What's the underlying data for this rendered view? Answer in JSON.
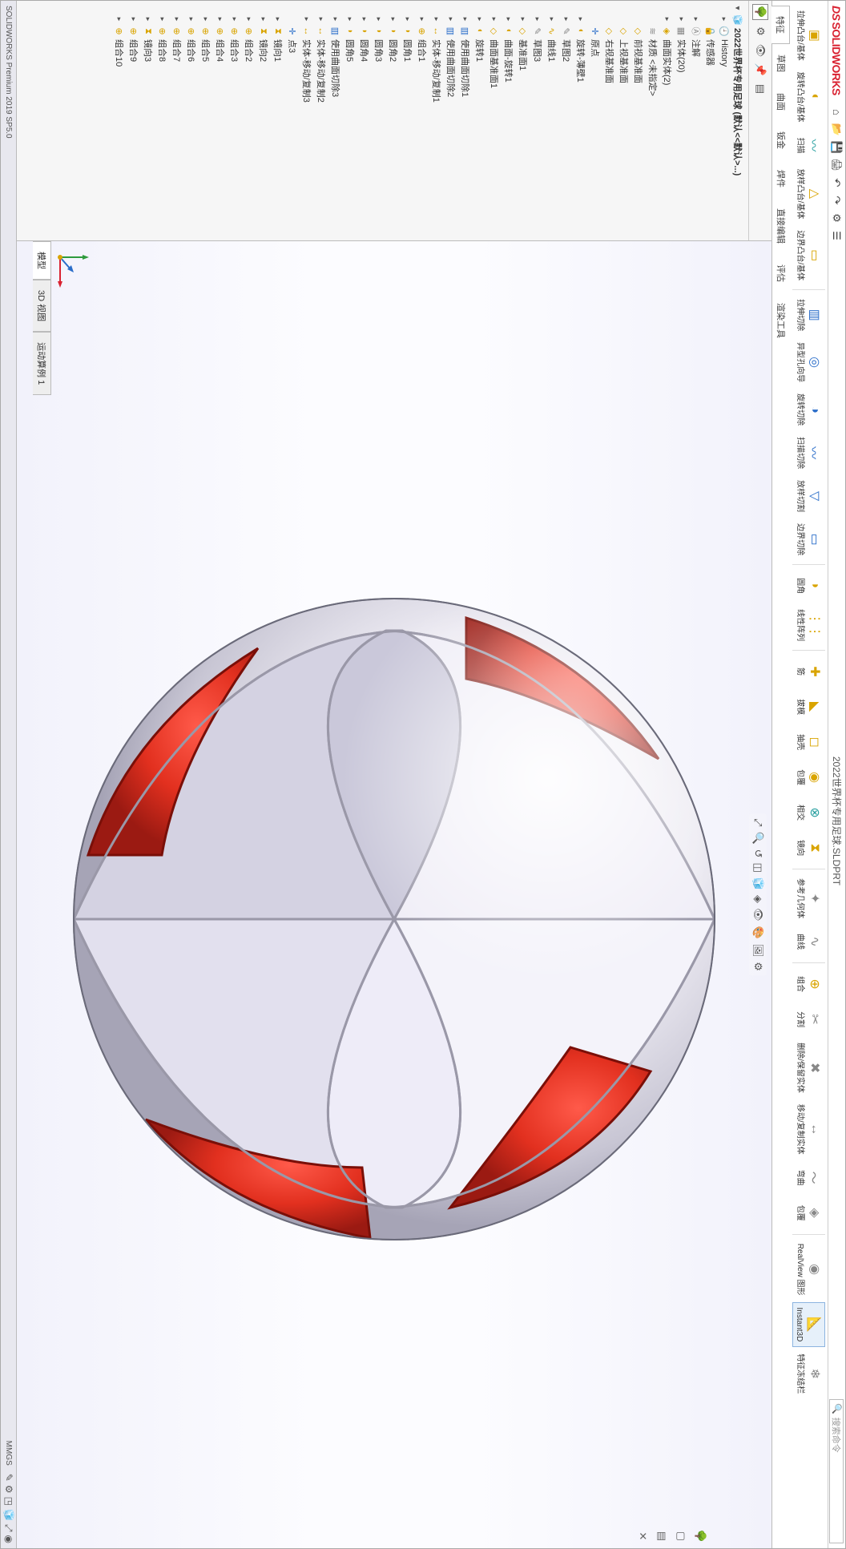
{
  "app": {
    "name": "SOLIDWORKS",
    "document": "2022世界杯专用足球.SLDPRT",
    "search_placeholder": "搜索命令"
  },
  "qat": [
    "home-icon",
    "open-icon",
    "save-icon",
    "print-icon",
    "undo-icon",
    "redo-icon",
    "settings-icon",
    "options-icon"
  ],
  "ribbon": {
    "row1": [
      {
        "id": "boss-extrude",
        "lbl": "拉伸凸台/基体",
        "glyph": "▣",
        "color": "c-yel"
      },
      {
        "id": "revolve-boss",
        "lbl": "旋转凸台/基体",
        "glyph": "◐",
        "color": "c-yel"
      },
      {
        "id": "sweep",
        "lbl": "扫描",
        "glyph": "〰",
        "color": "c-teal"
      },
      {
        "id": "loft",
        "lbl": "放样凸台/基体",
        "glyph": "△",
        "color": "c-yel"
      },
      {
        "id": "boundary",
        "lbl": "边界凸台/基体",
        "glyph": "▭",
        "color": "c-yel"
      },
      {
        "sep": true
      },
      {
        "id": "cut-extrude",
        "lbl": "拉伸切除",
        "glyph": "▥",
        "color": "c-blue"
      },
      {
        "id": "hole-wizard",
        "lbl": "异型孔向导",
        "glyph": "◎",
        "color": "c-blue"
      },
      {
        "id": "cut-revolve",
        "lbl": "旋转切除",
        "glyph": "◑",
        "color": "c-blue"
      },
      {
        "id": "cut-sweep",
        "lbl": "扫描切除",
        "glyph": "〰",
        "color": "c-blue"
      },
      {
        "id": "cut-loft",
        "lbl": "放样切割",
        "glyph": "▽",
        "color": "c-blue"
      },
      {
        "id": "cut-boundary",
        "lbl": "边界切除",
        "glyph": "▭",
        "color": "c-blue"
      },
      {
        "sep": true
      },
      {
        "id": "fillet",
        "lbl": "圆角",
        "glyph": "◗",
        "color": "c-yel"
      },
      {
        "id": "pattern",
        "lbl": "线性阵列",
        "glyph": "⋮⋮",
        "color": "c-yel"
      },
      {
        "sep": true
      },
      {
        "id": "rib",
        "lbl": "筋",
        "glyph": "✚",
        "color": "c-yel"
      },
      {
        "id": "draft",
        "lbl": "拔模",
        "glyph": "◣",
        "color": "c-yel"
      },
      {
        "id": "shell",
        "lbl": "抽壳",
        "glyph": "◻",
        "color": "c-yel"
      },
      {
        "id": "wrap",
        "lbl": "包覆",
        "glyph": "◉",
        "color": "c-yel"
      },
      {
        "id": "intersect",
        "lbl": "相交",
        "glyph": "⊗",
        "color": "c-teal"
      },
      {
        "id": "mirror",
        "lbl": "镜向",
        "glyph": "⧗",
        "color": "c-yel"
      },
      {
        "sep": true
      },
      {
        "id": "ref-geom",
        "lbl": "参考几何体",
        "glyph": "✦",
        "color": "c-gray"
      },
      {
        "id": "curves",
        "lbl": "曲线",
        "glyph": "∿",
        "color": "c-gray"
      },
      {
        "sep": true
      },
      {
        "id": "combine",
        "lbl": "组合",
        "glyph": "⊕",
        "color": "c-yel"
      },
      {
        "id": "split",
        "lbl": "分割",
        "glyph": "✂",
        "color": "c-gray"
      },
      {
        "id": "delete-body",
        "lbl": "删除/保留实体",
        "glyph": "✖",
        "color": "c-gray"
      },
      {
        "id": "move-body",
        "lbl": "移动/复制实体",
        "glyph": "↔",
        "color": "c-gray"
      },
      {
        "id": "flex",
        "lbl": "弯曲",
        "glyph": "〜",
        "color": "c-gray"
      },
      {
        "id": "convert",
        "lbl": "包覆",
        "glyph": "◈",
        "color": "c-gray"
      },
      {
        "sep": true
      },
      {
        "id": "realview",
        "lbl": "RealView 图形",
        "glyph": "◉",
        "color": "c-gray"
      },
      {
        "id": "instant3d",
        "lbl": "Instant3D",
        "glyph": "📐",
        "color": "c-yel",
        "active": true
      },
      {
        "id": "feature-repair",
        "lbl": "特征冻结栏",
        "glyph": "❄",
        "color": "c-gray"
      }
    ],
    "tabs": [
      "特征",
      "草图",
      "曲面",
      "钣金",
      "焊件",
      "直接编辑",
      "评估",
      "渲染工具"
    ]
  },
  "side_tabs": [
    "feature-tree-icon",
    "config-icon",
    "display-icon",
    "pin-icon",
    "expand-icon"
  ],
  "tree": [
    {
      "d": 0,
      "exp": "▾",
      "ico": "🧊",
      "lbl": "2022世界杯专用足球 (默认<<默认>...)",
      "root": true,
      "color": "c-yel"
    },
    {
      "d": 1,
      "exp": "▸",
      "ico": "🕘",
      "lbl": "History",
      "color": "c-gray"
    },
    {
      "d": 1,
      "exp": " ",
      "ico": "🔒",
      "lbl": "传感器",
      "color": "c-blue"
    },
    {
      "d": 1,
      "exp": "▸",
      "ico": "Ⓐ",
      "lbl": "注解",
      "color": "c-gray"
    },
    {
      "d": 1,
      "exp": "▸",
      "ico": "▦",
      "lbl": "实体(20)",
      "color": "c-gray"
    },
    {
      "d": 1,
      "exp": "▸",
      "ico": "◈",
      "lbl": "曲面实体(2)",
      "color": "c-yel"
    },
    {
      "d": 1,
      "exp": " ",
      "ico": "≋",
      "lbl": "材质 <未指定>",
      "color": "c-gray"
    },
    {
      "d": 1,
      "exp": " ",
      "ico": "◇",
      "lbl": "前视基准面",
      "color": "c-yel"
    },
    {
      "d": 1,
      "exp": " ",
      "ico": "◇",
      "lbl": "上视基准面",
      "color": "c-yel"
    },
    {
      "d": 1,
      "exp": " ",
      "ico": "◇",
      "lbl": "右视基准面",
      "color": "c-yel"
    },
    {
      "d": 1,
      "exp": " ",
      "ico": "✛",
      "lbl": "原点",
      "color": "c-blue"
    },
    {
      "d": 1,
      "exp": "▸",
      "ico": "◐",
      "lbl": "旋转-薄壁1",
      "color": "c-yel"
    },
    {
      "d": 1,
      "exp": "▸",
      "ico": "✎",
      "lbl": "草图2",
      "color": "c-gray"
    },
    {
      "d": 1,
      "exp": "▸",
      "ico": "∿",
      "lbl": "曲线1",
      "color": "c-yel"
    },
    {
      "d": 1,
      "exp": "▸",
      "ico": "✎",
      "lbl": "草图3",
      "color": "c-gray"
    },
    {
      "d": 1,
      "exp": "▸",
      "ico": "◇",
      "lbl": "基准面1",
      "color": "c-yel"
    },
    {
      "d": 1,
      "exp": "▸",
      "ico": "◐",
      "lbl": "曲面-旋转1",
      "color": "c-yel"
    },
    {
      "d": 1,
      "exp": "▸",
      "ico": "◇",
      "lbl": "曲面基准面1",
      "color": "c-yel"
    },
    {
      "d": 1,
      "exp": "▸",
      "ico": "◐",
      "lbl": "旋转1",
      "color": "c-yel"
    },
    {
      "d": 1,
      "exp": "▸",
      "ico": "▥",
      "lbl": "使用曲面切除1",
      "color": "c-blue"
    },
    {
      "d": 1,
      "exp": "▸",
      "ico": "▥",
      "lbl": "使用曲面切除2",
      "color": "c-blue"
    },
    {
      "d": 1,
      "exp": "▸",
      "ico": "↔",
      "lbl": "实体-移动/复制1",
      "color": "c-yel"
    },
    {
      "d": 1,
      "exp": "▸",
      "ico": "⊕",
      "lbl": "组合1",
      "color": "c-yel"
    },
    {
      "d": 1,
      "exp": "▸",
      "ico": "◗",
      "lbl": "圆角1",
      "color": "c-yel"
    },
    {
      "d": 1,
      "exp": "▸",
      "ico": "◗",
      "lbl": "圆角2",
      "color": "c-yel"
    },
    {
      "d": 1,
      "exp": "▸",
      "ico": "◗",
      "lbl": "圆角3",
      "color": "c-yel"
    },
    {
      "d": 1,
      "exp": "▸",
      "ico": "◗",
      "lbl": "圆角4",
      "color": "c-yel"
    },
    {
      "d": 1,
      "exp": "▸",
      "ico": "◗",
      "lbl": "圆角5",
      "color": "c-yel"
    },
    {
      "d": 1,
      "exp": "▸",
      "ico": "▥",
      "lbl": "使用曲面切除3",
      "color": "c-blue"
    },
    {
      "d": 1,
      "exp": "▸",
      "ico": "↔",
      "lbl": "实体-移动/复制2",
      "color": "c-yel"
    },
    {
      "d": 1,
      "exp": "▸",
      "ico": "↔",
      "lbl": "实体-移动/复制3",
      "color": "c-yel"
    },
    {
      "d": 1,
      "exp": " ",
      "ico": "✛",
      "lbl": "点3",
      "color": "c-blue"
    },
    {
      "d": 1,
      "exp": "▸",
      "ico": "⧗",
      "lbl": "镜向1",
      "color": "c-yel"
    },
    {
      "d": 1,
      "exp": "▸",
      "ico": "⧗",
      "lbl": "镜向2",
      "color": "c-yel"
    },
    {
      "d": 1,
      "exp": "▸",
      "ico": "⊕",
      "lbl": "组合2",
      "color": "c-yel"
    },
    {
      "d": 1,
      "exp": "▸",
      "ico": "⊕",
      "lbl": "组合3",
      "color": "c-yel"
    },
    {
      "d": 1,
      "exp": "▸",
      "ico": "⊕",
      "lbl": "组合4",
      "color": "c-yel"
    },
    {
      "d": 1,
      "exp": "▸",
      "ico": "⊕",
      "lbl": "组合5",
      "color": "c-yel"
    },
    {
      "d": 1,
      "exp": "▸",
      "ico": "⊕",
      "lbl": "组合6",
      "color": "c-yel"
    },
    {
      "d": 1,
      "exp": "▸",
      "ico": "⊕",
      "lbl": "组合7",
      "color": "c-yel"
    },
    {
      "d": 1,
      "exp": "▸",
      "ico": "⊕",
      "lbl": "组合8",
      "color": "c-yel"
    },
    {
      "d": 1,
      "exp": "▸",
      "ico": "⧗",
      "lbl": "镜向3",
      "color": "c-yel"
    },
    {
      "d": 1,
      "exp": "▸",
      "ico": "⊕",
      "lbl": "组合9",
      "color": "c-yel"
    },
    {
      "d": 1,
      "exp": "▸",
      "ico": "⊕",
      "lbl": "组合10",
      "color": "c-yel"
    }
  ],
  "hup": [
    "zoom-fit-icon",
    "zoom-area-icon",
    "prev-view-icon",
    "section-icon",
    "view-orient-icon",
    "display-style-icon",
    "hide-show-icon",
    "appearance-icon",
    "scene-icon",
    "view-settings-icon"
  ],
  "vbar": [
    "feature-tree-icon",
    "collapse-icon",
    "expand-icon",
    "close-icon"
  ],
  "bottom_tabs": [
    "模型",
    "3D 视图",
    "运动算例 1"
  ],
  "status": {
    "left": "SOLIDWORKS Premium 2019 SP5.0",
    "units": "MMGS"
  }
}
